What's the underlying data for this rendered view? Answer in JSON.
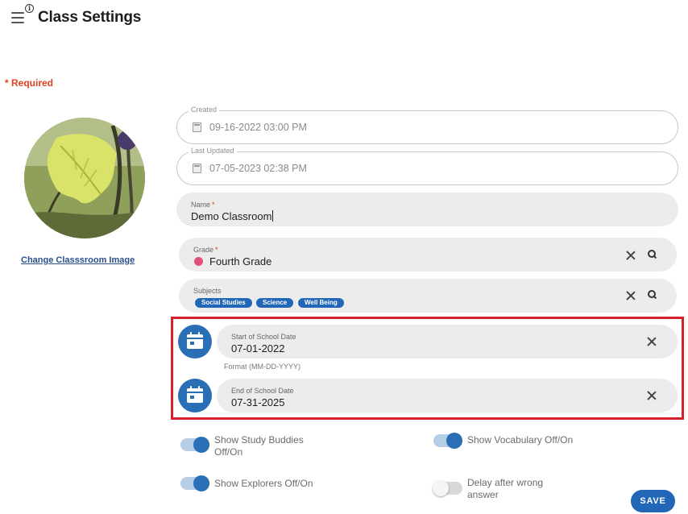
{
  "header": {
    "title": "Class Settings",
    "menu_icon": "hamburger-icon",
    "info_icon": "info-icon",
    "info_glyph": "i"
  },
  "required_note": "* Required",
  "avatar": {
    "change_label": "Change Classsroom Image"
  },
  "created": {
    "label": "Created",
    "value": "09-16-2022 03:00 PM",
    "icon": "calendar-icon"
  },
  "last_updated": {
    "label": "Last Updated",
    "value": "07-05-2023 02:38 PM",
    "icon": "calendar-icon"
  },
  "name_field": {
    "label": "Name",
    "required_mark": "*",
    "value": "Demo Classroom"
  },
  "grade_field": {
    "label": "Grade",
    "required_mark": "*",
    "value": "Fourth Grade",
    "dot_color": "#e0507a"
  },
  "subjects_field": {
    "label": "Subjects",
    "chips": [
      "Social Studies",
      "Science",
      "Well Being"
    ]
  },
  "start_date": {
    "label": "Start of School Date",
    "value": "07-01-2022"
  },
  "date_format_hint": "Format (MM-DD-YYYY)",
  "end_date": {
    "label": "End of School Date",
    "value": "07-31-2025"
  },
  "toggles": {
    "study_buddies": {
      "line1": "Show Study Buddies",
      "line2": "Off/On",
      "on": true
    },
    "vocabulary": {
      "line1": "Show Vocabulary Off/On",
      "on": true
    },
    "explorers": {
      "line1": "Show Explorers Off/On",
      "on": true
    },
    "delay_wrong": {
      "line1": "Delay after wrong",
      "line2": "answer",
      "on": false
    }
  },
  "save_label": "SAVE",
  "colors": {
    "accent": "#2266b8",
    "required": "#e0401b",
    "highlight_border": "#d61f2b"
  }
}
